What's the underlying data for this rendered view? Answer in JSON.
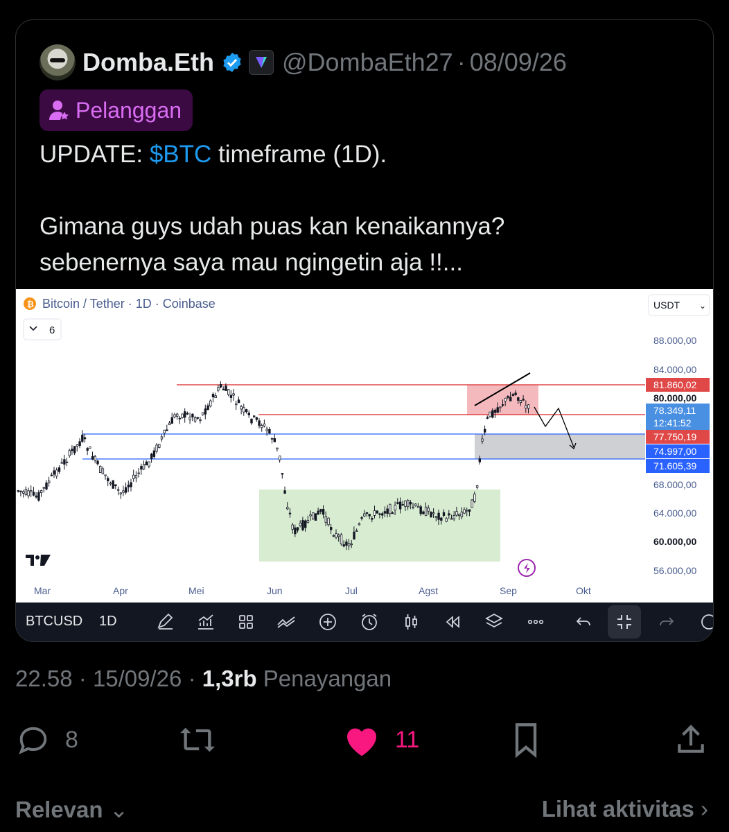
{
  "tweet": {
    "display_name": "Domba.Eth",
    "handle": "@DombaEth27",
    "sep": "·",
    "date": "08/09/26",
    "badge_label": "Pelanggan",
    "text_prefix": "UPDATE: ",
    "text_cashtag": "$BTC",
    "text_rest": " timeframe (1D).\n\nGimana guys udah puas kan kenaikannya?\nsebenernya saya mau ngingetin aja !!..."
  },
  "chart": {
    "title": "Bitcoin / Tether · 1D · Coinbase",
    "currency_select": "USDT",
    "indicator_count": "6",
    "price_levels": [
      "88.000,00",
      "84.000,00",
      "80.000,00",
      "68.000,00",
      "64.000,00",
      "60.000,00",
      "56.000,00"
    ],
    "tags": {
      "resist": "81.860,02",
      "current": "78.349,11",
      "countdown": "12:41:52",
      "support": "77.750,19",
      "zone_top": "74.997,00",
      "zone_bottom": "71.605,39"
    },
    "months": [
      "Mar",
      "Apr",
      "Mei",
      "Jun",
      "Jul",
      "Agst",
      "Sep",
      "Okt"
    ],
    "toolbar_symbol": "BTCUSD",
    "toolbar_timeframe": "1D",
    "colors": {
      "red_line": "#e04848",
      "blue_line": "#2962ff",
      "green_zone": "#d8ecd2",
      "pink_zone": "#f4b9bd",
      "gray_zone": "#cfd0d3"
    }
  },
  "meta": {
    "time": "22.58",
    "date": "15/09/26",
    "views_count": "1,3rb",
    "views_label": "Penayangan",
    "sep": "·"
  },
  "actions": {
    "replies": "8",
    "likes": "11"
  },
  "footer": {
    "sort_label": "Relevan",
    "activity_label": "Lihat aktivitas"
  }
}
